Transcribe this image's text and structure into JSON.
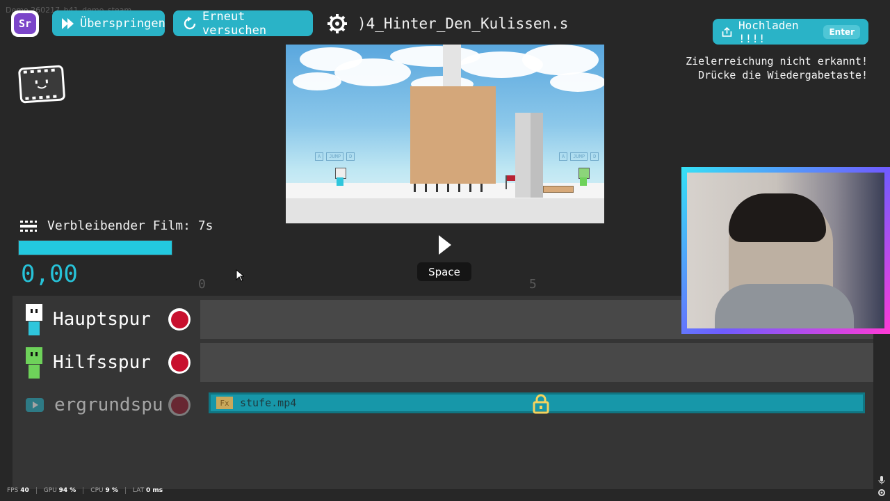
{
  "watermark": "Demo 260217_b41_demo_steam",
  "logo": {
    "text": "Sr"
  },
  "toolbar": {
    "skip_label": "Überspringen",
    "retry_label": "Erneut versuchen",
    "level_name": ")4_Hinter_Den_Kulissen.s"
  },
  "upload": {
    "label": "Hochladen !!!!",
    "key": "Enter"
  },
  "goal_message": {
    "line1": "Zielerreichung nicht erkannt!",
    "line2": "Drücke die Wiedergabetaste!"
  },
  "preview": {
    "jump_hint_left": [
      "A",
      "JUMP",
      "D"
    ],
    "jump_hint_right": [
      "A",
      "JUMP",
      "D"
    ]
  },
  "playback": {
    "key": "Space"
  },
  "film": {
    "label": "Verbleibender Film: 7s",
    "remaining_fraction": 1.0
  },
  "timer": {
    "value": "0,00"
  },
  "timeline": {
    "ticks": [
      "0",
      "5"
    ]
  },
  "tracks": [
    {
      "name": "Hauptspur",
      "color": "#2fc6dc"
    },
    {
      "name": "Hilfsspur",
      "color": "#6ed25a"
    },
    {
      "name": "ergrundspu",
      "clip": {
        "fx": "Fx",
        "name": "stufe.mp4"
      }
    }
  ],
  "colors": {
    "accent": "#2ab3c7",
    "record": "#c8102e",
    "timer": "#27c2d8"
  },
  "status_bar": [
    {
      "label": "FPS",
      "value": "40"
    },
    {
      "label": "GPU",
      "value": "94 %"
    },
    {
      "label": "CPU",
      "value": "9 %"
    },
    {
      "label": "LAT",
      "value": "0 ms"
    }
  ]
}
